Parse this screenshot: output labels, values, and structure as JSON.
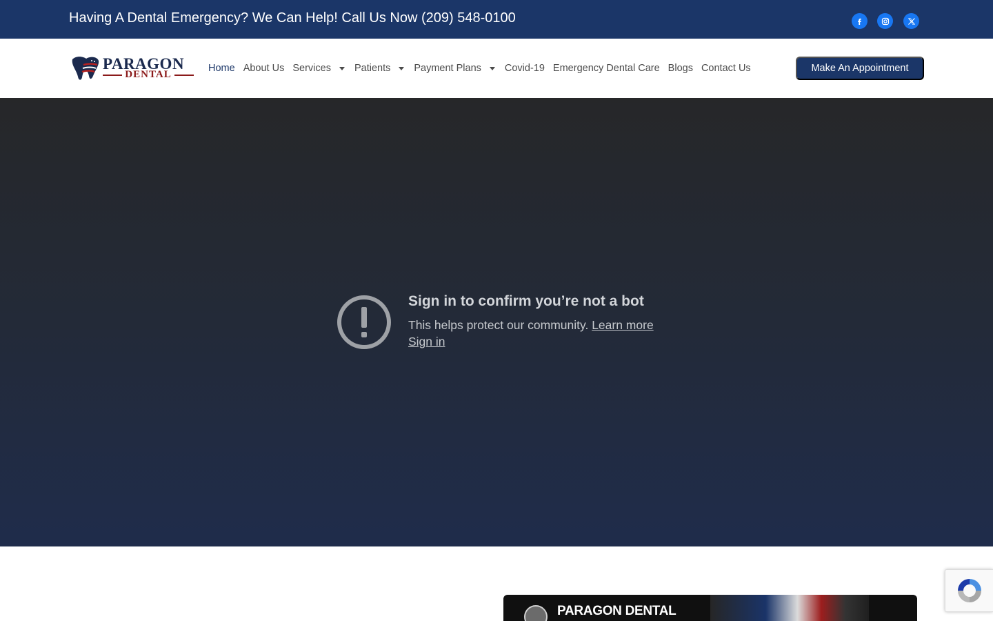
{
  "topbar": {
    "emergency_text": "Having A Dental Emergency? We Can Help! Call Us Now (209) 548-0100",
    "social": [
      {
        "icon": "facebook-icon",
        "color": "#1877f2"
      },
      {
        "icon": "instagram-icon",
        "color": "#1877f2"
      },
      {
        "icon": "x-twitter-icon",
        "color": "#1877f2"
      }
    ]
  },
  "header": {
    "logo": {
      "line1": "PARAGON",
      "line2": "DENTAL"
    },
    "nav": [
      {
        "label": "Home",
        "active": true
      },
      {
        "label": "About Us"
      },
      {
        "label": "Services",
        "dropdown": true
      },
      {
        "label": "Patients",
        "dropdown": true
      },
      {
        "label": "Payment Plans",
        "dropdown": true
      },
      {
        "label": "Covid-19"
      },
      {
        "label": "Emergency Dental Care"
      },
      {
        "label": "Blogs"
      },
      {
        "label": "Contact Us"
      }
    ],
    "cta_label": "Make An Appointment"
  },
  "embed": {
    "title": "Sign in to confirm you’re not a bot",
    "body": "This helps protect our community.",
    "learn_more": "Learn more",
    "sign_in": "Sign in"
  },
  "video_preview": {
    "channel_title": "PARAGON DENTAL"
  },
  "colors": {
    "brand_navy": "#1b3668",
    "brand_red": "#8b1a1a",
    "social_blue": "#1877f2"
  }
}
